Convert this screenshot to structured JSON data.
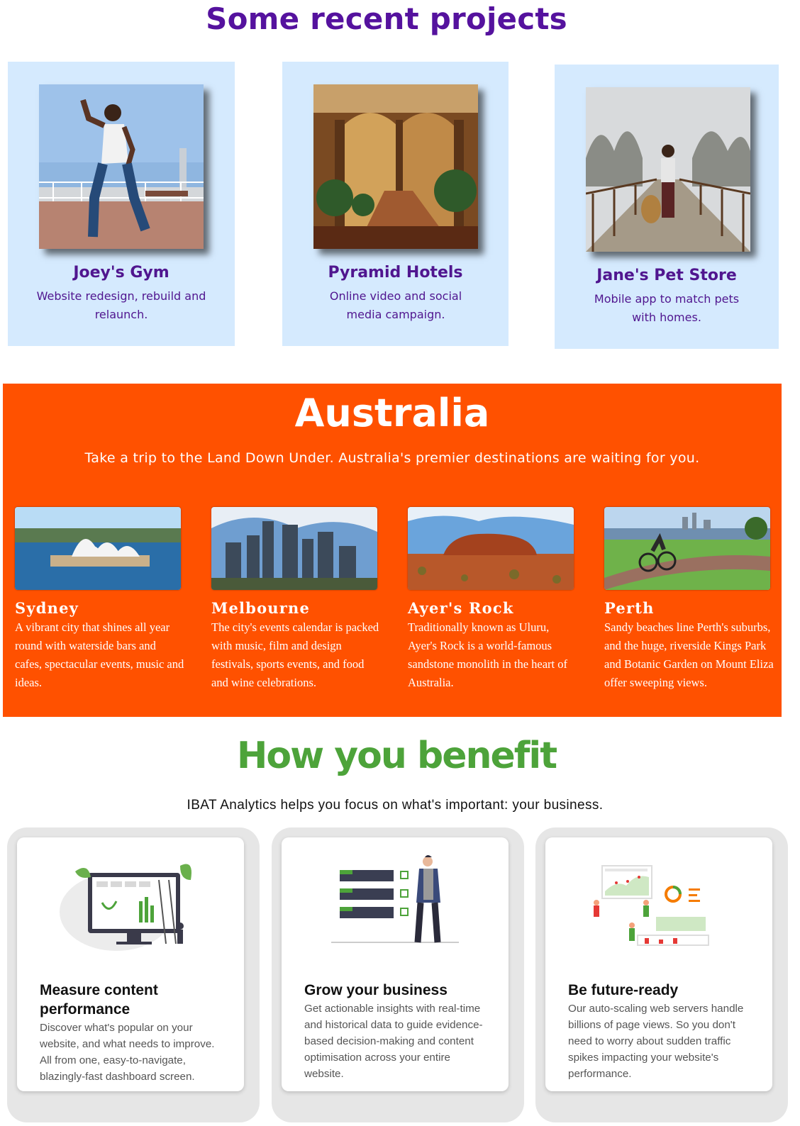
{
  "projects": {
    "title": "Some recent projects",
    "items": [
      {
        "name": "Joey's Gym",
        "desc": "Website redesign, rebuild and relaunch."
      },
      {
        "name": "Pyramid Hotels",
        "desc": "Online video and social media campaign."
      },
      {
        "name": "Jane's Pet Store",
        "desc": "Mobile app to match pets with homes."
      }
    ]
  },
  "australia": {
    "title": "Australia",
    "subtitle": "Take a trip to the Land Down Under. Australia's premier destinations are waiting for you.",
    "destinations": [
      {
        "name": "Sydney",
        "desc": "A vibrant city that shines all year round with waterside bars and cafes, spectacular events, music and ideas."
      },
      {
        "name": "Melbourne",
        "desc": "The city's events calendar is packed with music, film and design festivals, sports events, and food and wine celebrations."
      },
      {
        "name": "Ayer's Rock",
        "desc": "Traditionally known as Uluru, Ayer's Rock is a world-famous sandstone monolith in the heart of Australia."
      },
      {
        "name": "Perth",
        "desc": "Sandy beaches line Perth's suburbs, and the huge, riverside Kings Park and Botanic Garden on Mount Eliza offer sweeping views."
      }
    ]
  },
  "benefits": {
    "title": "How you benefit",
    "subtitle": "IBAT Analytics helps you focus on what's important: your business.",
    "items": [
      {
        "name": "Measure content performance",
        "desc": "Discover what's popular on your website, and what needs to improve. All from one, easy-to-navigate, blazingly-fast dashboard screen."
      },
      {
        "name": "Grow your business",
        "desc": "Get actionable insights with real-time and historical data to guide evidence-based decision-making and content optimisation across your entire website."
      },
      {
        "name": "Be future-ready",
        "desc": "Our auto-scaling web servers handle billions of page views. So you don't need to worry about sudden traffic spikes impacting your website's performance."
      }
    ]
  }
}
